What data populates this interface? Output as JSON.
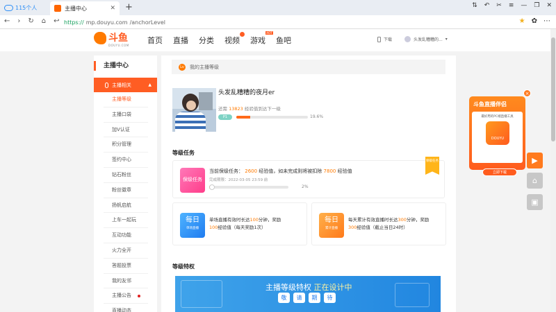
{
  "browser": {
    "tab_115": "115个人",
    "active_tab": "主播中心",
    "url_scheme": "https://",
    "url_host": "mp.douyu.com",
    "url_path": "/anchorLevel"
  },
  "site": {
    "logo_text": "斗鱼",
    "logo_sub": "DOUYU.COM",
    "nav": [
      "首页",
      "直播",
      "分类",
      "视频",
      "游戏",
      "鱼吧"
    ],
    "nav_hot_tag": "HOT",
    "download_label": "下载",
    "user_name": "头发乱糟糟的..."
  },
  "sidebar": {
    "title": "主播中心",
    "group_label": "主播相关",
    "items": [
      "主播等级",
      "主播口袋",
      "加V认证",
      "积分管理",
      "签约中心",
      "钻石粉丝",
      "粉丝徽章",
      "扬帆启航",
      "上车一起玩",
      "互动功能",
      "火力全开",
      "答题投票",
      "我的友邻",
      "主播公告",
      "直播动态"
    ],
    "active_index": 0
  },
  "level": {
    "section_title": "我的主播等级",
    "section_icon_text": "Lv",
    "username": "头发乱糟糟的夜月er",
    "exp_prefix": "还需",
    "exp_needed": "13823",
    "exp_suffix": "经验值到达下一级",
    "level_badge": "P1",
    "progress_label": "19.6%",
    "progress": 0.196
  },
  "tasks": {
    "heading": "等级任务",
    "ribbon": "保级任务",
    "protect": {
      "icon": "保级任务",
      "label": "当前保级任务：",
      "value": "2600",
      "mid": "经验值，如未完成则将被扣除",
      "penalty": "7800",
      "tail": "经验值",
      "deadline": "完成期限：2022-03-05 23:59 前",
      "progress_label": "2%",
      "progress": 0.02
    },
    "daily_single": {
      "icon_big": "每日",
      "icon_small": "单场直播",
      "t1": "单场直播有效时长达",
      "v1": "100",
      "t2": "分钟，奖励",
      "v2": "100",
      "t3": "经验值（每天奖励1次）"
    },
    "daily_total": {
      "icon_big": "每日",
      "icon_small": "累计直播",
      "t1": "每天累计有效直播时长达",
      "v1": "300",
      "t2": "分钟，奖励",
      "v2": "300",
      "t3": "经验值（截止当日24时）"
    }
  },
  "privileges": {
    "heading": "等级特权",
    "banner_title": "主播等级特权",
    "banner_highlight": "正在设计中",
    "chips": [
      "敬",
      "请",
      "期",
      "待"
    ]
  },
  "promo": {
    "title": "斗鱼直播伴侣",
    "desc": "最好用的PC端直播工具",
    "app_label": "DOUYU",
    "button": "立即下载",
    "close": "×"
  },
  "colors": {
    "brand": "#ff5d23",
    "accent": "#ff7a00"
  }
}
